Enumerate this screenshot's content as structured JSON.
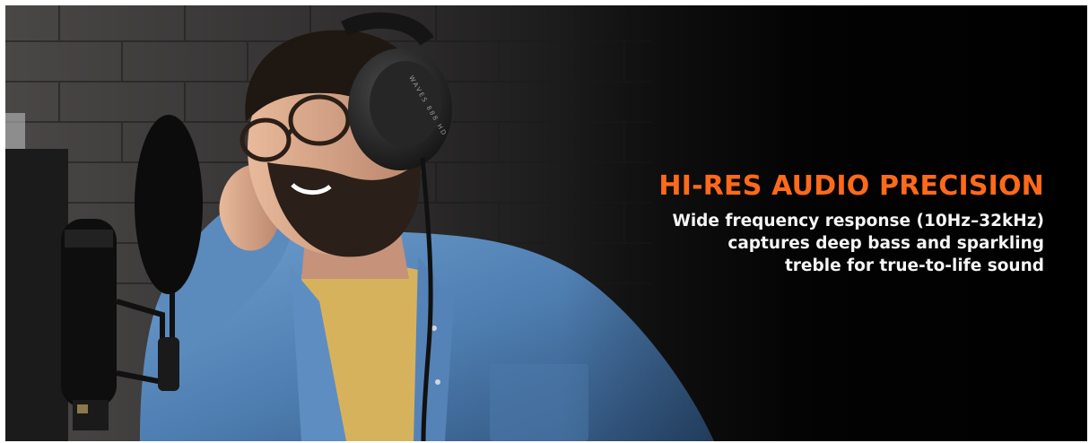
{
  "banner": {
    "headline": "HI-RES AUDIO PRECISION",
    "description_lines": [
      "Wide frequency response (10Hz–32kHz)",
      "captures deep bass and sparkling",
      "treble for true-to-life sound"
    ],
    "headphone_brand_text": "WAVES 888 HD"
  },
  "colors": {
    "accent": "#ff6a1a",
    "background": "#050505",
    "text": "#f5f5f5"
  }
}
